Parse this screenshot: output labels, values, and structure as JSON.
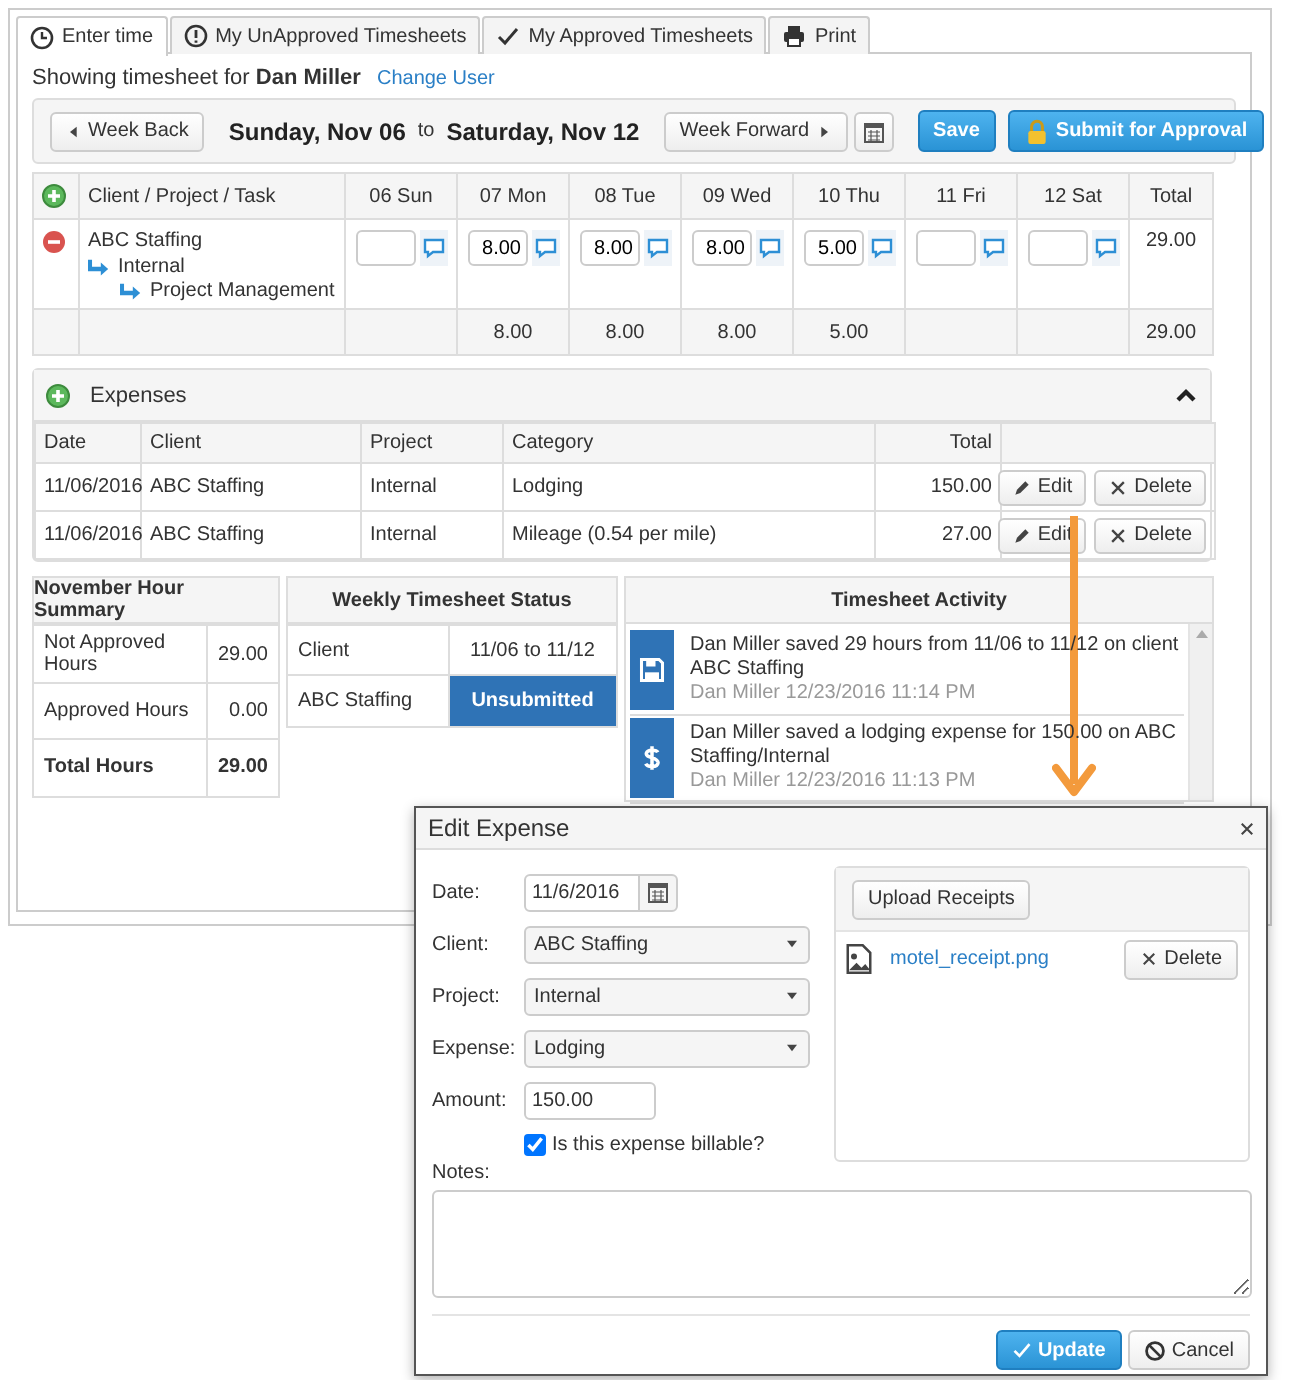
{
  "tabs": [
    {
      "label": "Enter time",
      "selected": true
    },
    {
      "label": "My UnApproved Timesheets",
      "selected": false
    },
    {
      "label": "My Approved Timesheets",
      "selected": false
    },
    {
      "label": "Print",
      "selected": false
    }
  ],
  "showing": "Showing timesheet for **Dan Miller**",
  "change_user": "Change User",
  "week": {
    "back": "Week Back",
    "start": "Sunday, Nov 06",
    "separator": "to",
    "end": "Saturday, Nov 12",
    "forward": "Week Forward",
    "save": "Save",
    "submit": "Submit for Approval"
  },
  "grid": {
    "columns": [
      "Client / Project / Task",
      "06 Sun",
      "07 Mon",
      "08 Tue",
      "09 Wed",
      "10 Thu",
      "11 Fri",
      "12 Sat",
      "Total"
    ],
    "rows": [
      {
        "client": "ABC Staffing",
        "project": "Internal",
        "task": "Project Management",
        "hours": {
          "mon": "8.00",
          "tue": "8.00",
          "wed": "8.00",
          "thu": "5.00"
        },
        "total": "29.00"
      }
    ],
    "totals": {
      "mon": "8.00",
      "tue": "8.00",
      "wed": "8.00",
      "thu": "5.00"
    },
    "grand_total": "29.00"
  },
  "expenses": {
    "title": "Expenses",
    "expanded": true,
    "columns": [
      "Date",
      "Client",
      "Project",
      "Category",
      "Total"
    ],
    "rows": [
      {
        "date": "11/06/2016",
        "client": "ABC Staffing",
        "project": "Internal",
        "category": "Lodging",
        "total": "150.00",
        "edit": "Edit",
        "delete": "Delete"
      },
      {
        "date": "11/06/2016",
        "client": "ABC Staffing",
        "project": "Internal",
        "category": "Mileage (0.54 per mile)",
        "total": "27.00",
        "edit": "Edit",
        "delete": "Delete"
      }
    ]
  },
  "summary": {
    "title": "November Hour Summary",
    "rows": [
      {
        "label": "Not Approved Hours",
        "value": "29.00",
        "kind": "plain"
      },
      {
        "label": "Approved Hours",
        "value": "0.00",
        "kind": "plain"
      },
      {
        "label": "Total Hours",
        "value": "29.00",
        "kind": "total"
      }
    ]
  },
  "status": {
    "title": "Weekly Timesheet Status",
    "columns": [
      "Client",
      "11/06 to 11/12"
    ],
    "rows": [
      {
        "client": "ABC Staffing",
        "status": "Unsubmitted"
      }
    ]
  },
  "activity": {
    "title": "Timesheet Activity",
    "items": [
      {
        "kind": "save",
        "text": "Dan Miller saved 29 hours from 11/06 to 11/12 on client ABC Staffing",
        "meta": "Dan Miller 12/23/2016 11:14 PM"
      },
      {
        "kind": "expense",
        "text": "Dan Miller saved a lodging expense for 150.00 on ABC Staffing/Internal",
        "meta": "Dan Miller 12/23/2016 11:13 PM"
      }
    ]
  },
  "modal": {
    "title": "Edit Expense",
    "date": {
      "label": "Date:",
      "value": "11/6/2016"
    },
    "selects": [
      {
        "label": "Client:",
        "value": "ABC Staffing"
      },
      {
        "label": "Project:",
        "value": "Internal"
      },
      {
        "label": "Expense:",
        "value": "Lodging"
      }
    ],
    "amount": {
      "label": "Amount:",
      "value": "150.00"
    },
    "billable": {
      "label": "Is this expense billable?",
      "checked": true
    },
    "notes": {
      "label": "Notes:"
    },
    "upload": "Upload Receipts",
    "receipts": [
      {
        "file": "motel_receipt.png",
        "delete": "Delete"
      }
    ],
    "update": "Update",
    "cancel": "Cancel"
  }
}
